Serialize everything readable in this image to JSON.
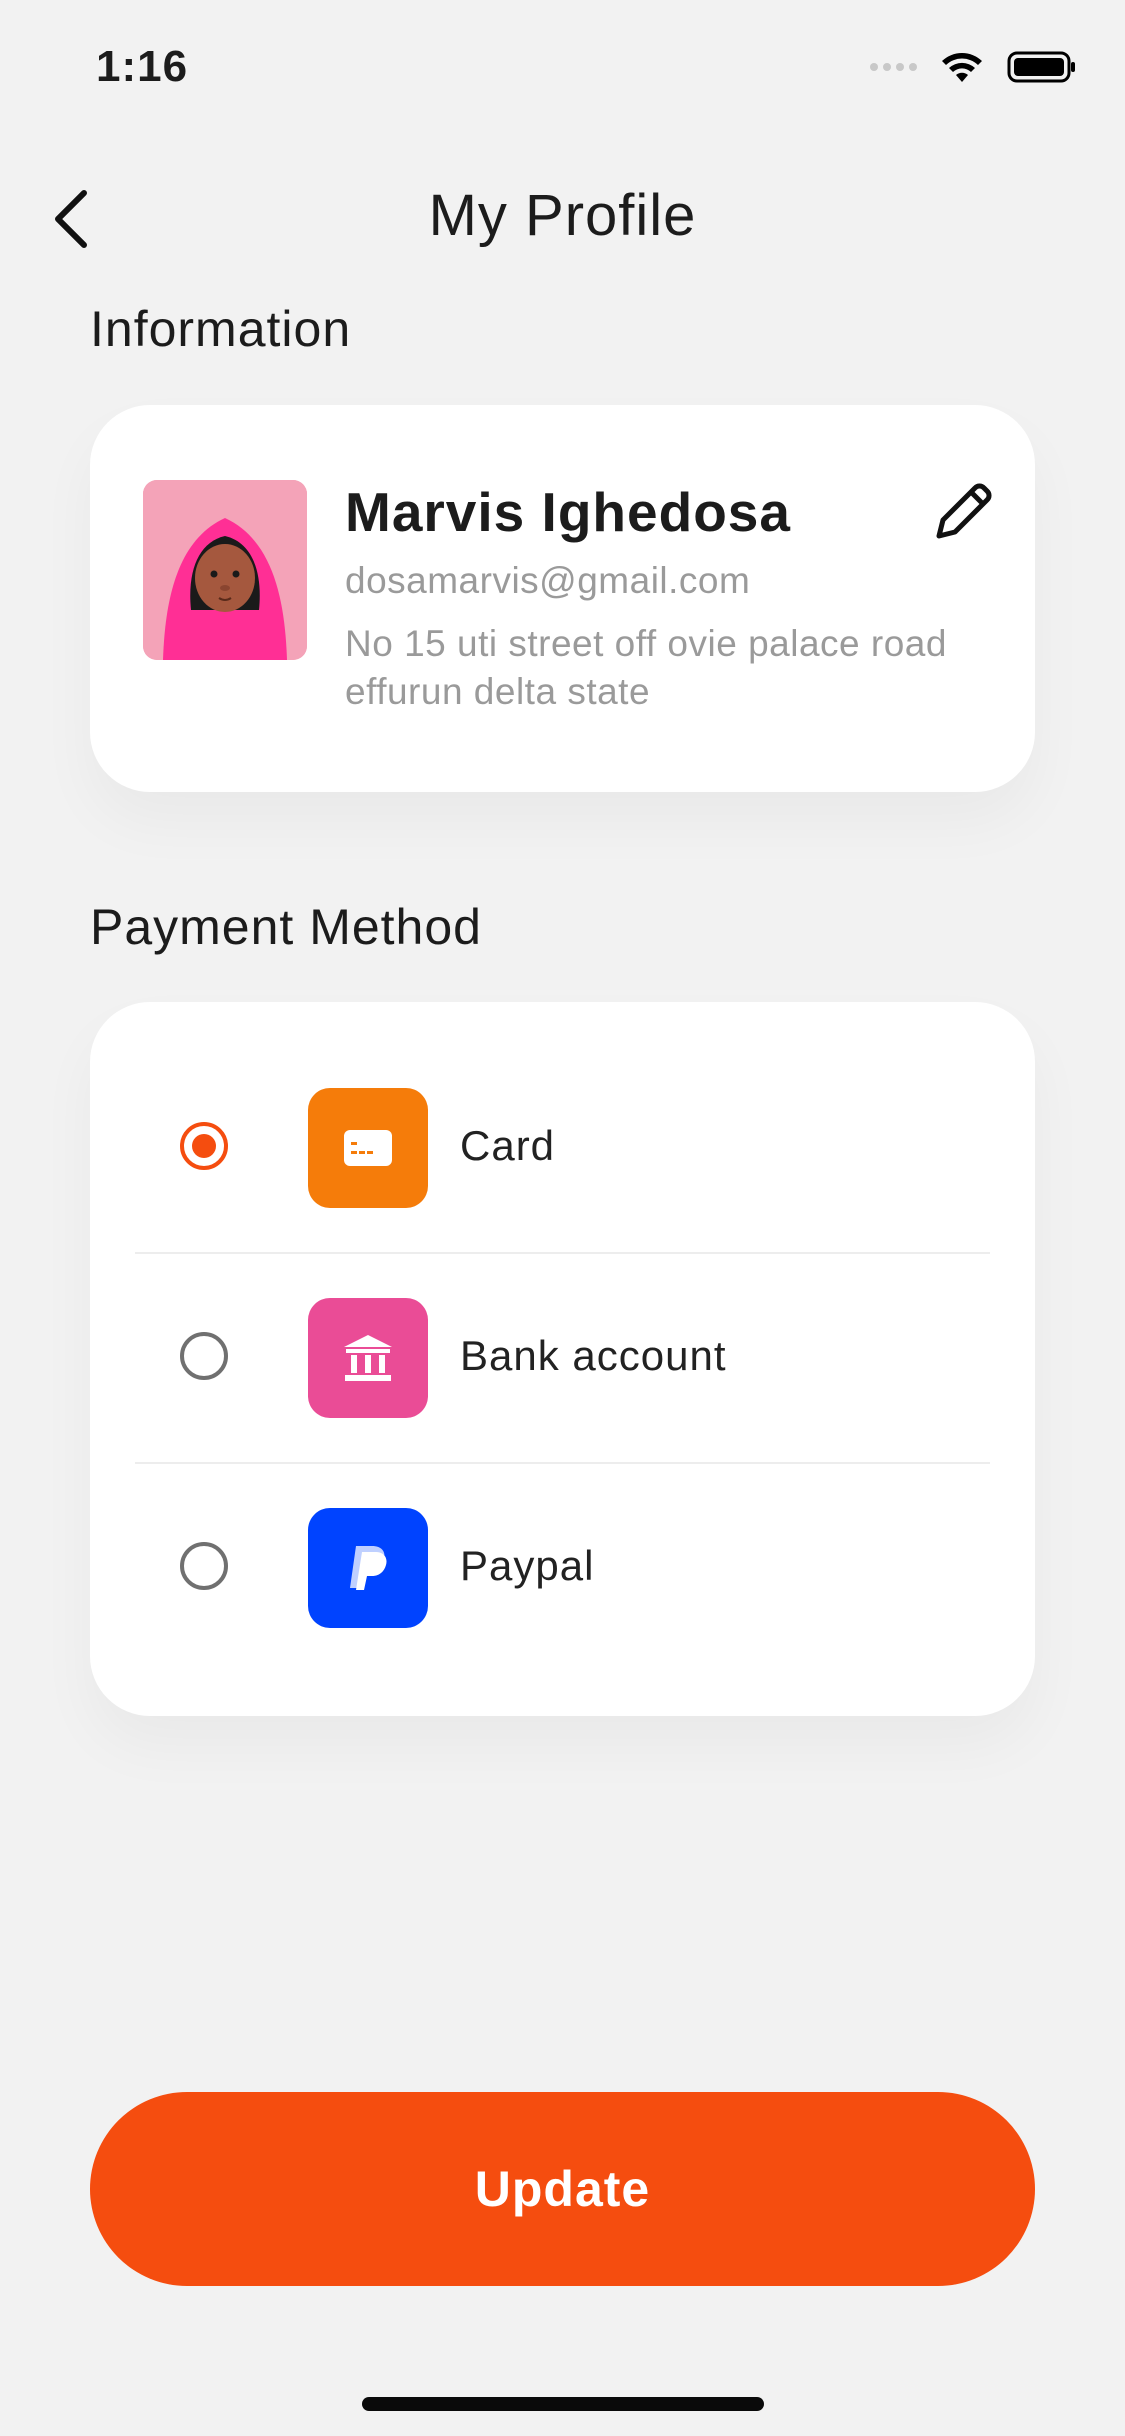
{
  "status_bar": {
    "time": "1:16"
  },
  "header": {
    "title": "My Profile"
  },
  "information": {
    "section_title": "Information",
    "name": "Marvis Ighedosa",
    "email": "dosamarvis@gmail.com",
    "address": "No 15 uti street off ovie palace road effurun delta state"
  },
  "payment": {
    "section_title": "Payment Method",
    "selected": "Card",
    "methods": [
      {
        "label": "Card",
        "icon": "card-icon",
        "color": "#f57c0a"
      },
      {
        "label": "Bank account",
        "icon": "bank-icon",
        "color": "#ea4c96"
      },
      {
        "label": "Paypal",
        "icon": "paypal-icon",
        "color": "#0043ff"
      }
    ]
  },
  "actions": {
    "update_label": "Update"
  },
  "colors": {
    "accent": "#f54d0f",
    "background": "#f2f2f2"
  }
}
